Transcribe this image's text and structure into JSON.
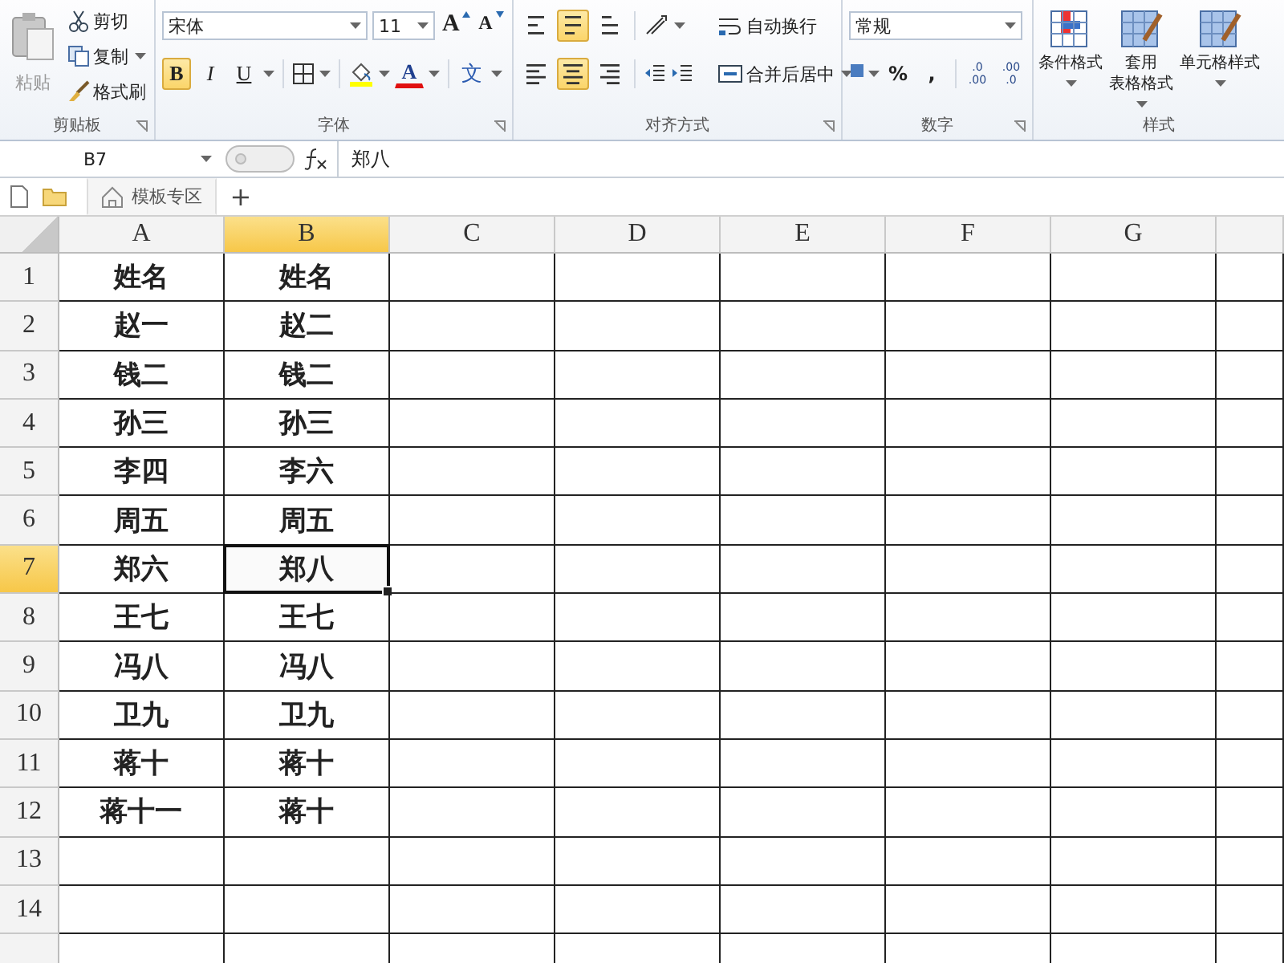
{
  "ribbon": {
    "clipboard": {
      "label": "剪贴板",
      "paste": "粘贴",
      "cut": "剪切",
      "copy": "复制",
      "format_painter": "格式刷"
    },
    "font": {
      "label": "字体",
      "font_name": "宋体",
      "font_size": "11",
      "grow": "A",
      "shrink": "A",
      "bold": {
        "text": "B",
        "pressed": true
      },
      "italic": {
        "text": "I",
        "pressed": false
      },
      "underline": {
        "text": "U",
        "pressed": false
      },
      "font_color": "A",
      "phonetic": "文"
    },
    "alignment": {
      "label": "对齐方式",
      "vertical": [
        {
          "kind": "top",
          "pressed": false
        },
        {
          "kind": "middle",
          "pressed": true
        },
        {
          "kind": "bottom",
          "pressed": false
        }
      ],
      "horizontal": [
        {
          "kind": "left",
          "pressed": false
        },
        {
          "kind": "center",
          "pressed": true
        },
        {
          "kind": "right",
          "pressed": false
        }
      ],
      "wrap_text": "自动换行",
      "merge_center": "合并后居中"
    },
    "number": {
      "label": "数字",
      "format": "常规",
      "percent": "%",
      "comma": ",",
      "increase_decimal": [
        ".0",
        ".00"
      ],
      "decrease_decimal": [
        ".00",
        ".0"
      ]
    },
    "styles": {
      "label": "样式",
      "buttons": [
        {
          "lines": [
            "条件格式"
          ]
        },
        {
          "lines": [
            "套用",
            "表格格式"
          ]
        },
        {
          "lines": [
            "单元格样式"
          ]
        }
      ]
    }
  },
  "formula_bar": {
    "name_box": "B7",
    "formula": "郑八"
  },
  "tab_bar": {
    "tabs": [
      {
        "label": "模板专区"
      }
    ],
    "add": "+"
  },
  "sheet": {
    "columns": [
      {
        "label": "A",
        "selected": false
      },
      {
        "label": "B",
        "selected": true
      },
      {
        "label": "C",
        "selected": false
      },
      {
        "label": "D",
        "selected": false
      },
      {
        "label": "E",
        "selected": false
      },
      {
        "label": "F",
        "selected": false
      },
      {
        "label": "G",
        "selected": false
      }
    ],
    "rows": [
      {
        "number": "1",
        "selected": false,
        "cells": [
          {
            "text": "姓名",
            "selected": false
          },
          {
            "text": "姓名",
            "selected": false
          }
        ]
      },
      {
        "number": "2",
        "selected": false,
        "cells": [
          {
            "text": "赵一",
            "selected": false
          },
          {
            "text": "赵二",
            "selected": false
          }
        ]
      },
      {
        "number": "3",
        "selected": false,
        "cells": [
          {
            "text": "钱二",
            "selected": false
          },
          {
            "text": "钱二",
            "selected": false
          }
        ]
      },
      {
        "number": "4",
        "selected": false,
        "cells": [
          {
            "text": "孙三",
            "selected": false
          },
          {
            "text": "孙三",
            "selected": false
          }
        ]
      },
      {
        "number": "5",
        "selected": false,
        "cells": [
          {
            "text": "李四",
            "selected": false
          },
          {
            "text": "李六",
            "selected": false
          }
        ]
      },
      {
        "number": "6",
        "selected": false,
        "cells": [
          {
            "text": "周五",
            "selected": false
          },
          {
            "text": "周五",
            "selected": false
          }
        ]
      },
      {
        "number": "7",
        "selected": true,
        "cells": [
          {
            "text": "郑六",
            "selected": false
          },
          {
            "text": "郑八",
            "selected": true
          }
        ]
      },
      {
        "number": "8",
        "selected": false,
        "cells": [
          {
            "text": "王七",
            "selected": false
          },
          {
            "text": "王七",
            "selected": false
          }
        ]
      },
      {
        "number": "9",
        "selected": false,
        "cells": [
          {
            "text": "冯八",
            "selected": false
          },
          {
            "text": "冯八",
            "selected": false
          }
        ]
      },
      {
        "number": "10",
        "selected": false,
        "cells": [
          {
            "text": "卫九",
            "selected": false
          },
          {
            "text": "卫九",
            "selected": false
          }
        ]
      },
      {
        "number": "11",
        "selected": false,
        "cells": [
          {
            "text": "蒋十",
            "selected": false
          },
          {
            "text": "蒋十",
            "selected": false
          }
        ]
      },
      {
        "number": "12",
        "selected": false,
        "cells": [
          {
            "text": "蒋十一",
            "selected": false
          },
          {
            "text": "蒋十",
            "selected": false
          }
        ]
      },
      {
        "number": "13",
        "selected": false,
        "cells": []
      },
      {
        "number": "14",
        "selected": false,
        "cells": []
      }
    ]
  }
}
